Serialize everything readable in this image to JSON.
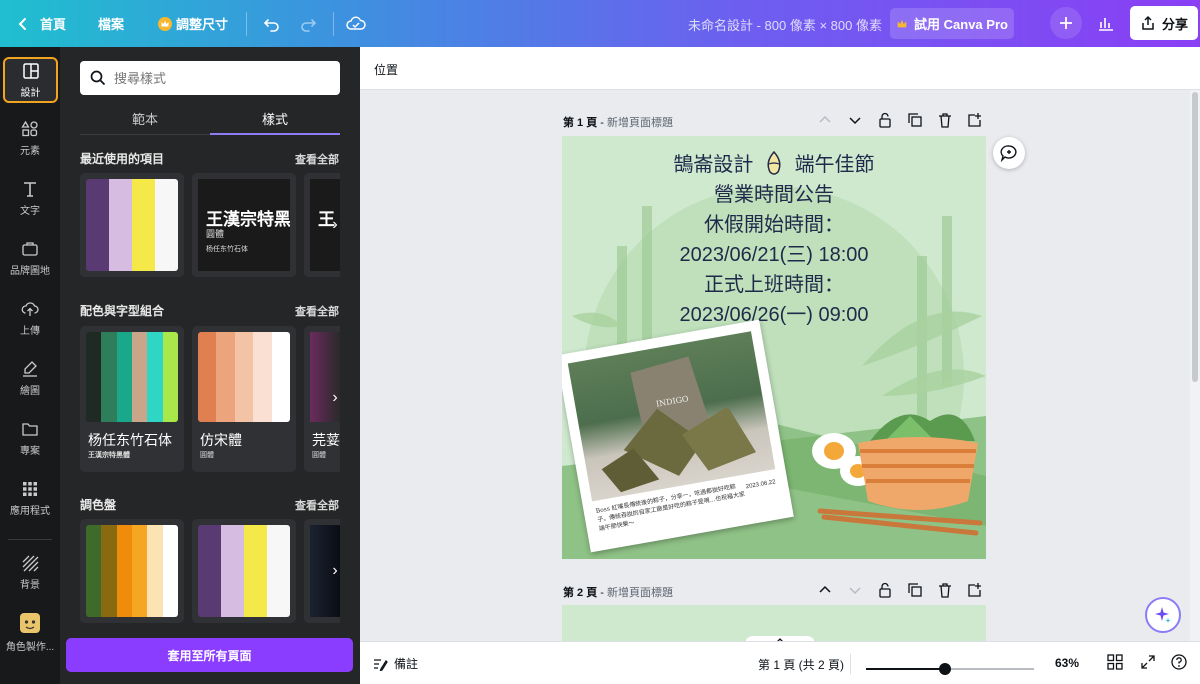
{
  "topbar": {
    "home": "首頁",
    "file": "檔案",
    "resize": "調整尺寸",
    "title": "未命名設計 - 800 像素 × 800 像素",
    "pro": "試用 Canva Pro",
    "share": "分享"
  },
  "rail": [
    {
      "label": "設計",
      "icon": "layout-icon"
    },
    {
      "label": "元素",
      "icon": "shapes-icon"
    },
    {
      "label": "文字",
      "icon": "text-icon"
    },
    {
      "label": "品牌圖地",
      "icon": "brand-icon"
    },
    {
      "label": "上傳",
      "icon": "upload-icon"
    },
    {
      "label": "繪圖",
      "icon": "draw-icon"
    },
    {
      "label": "專案",
      "icon": "folder-icon"
    },
    {
      "label": "應用程式",
      "icon": "apps-icon"
    },
    {
      "label": "背景",
      "icon": "background-icon"
    },
    {
      "label": "角色製作...",
      "icon": "character-icon"
    }
  ],
  "panel": {
    "search_placeholder": "搜尋樣式",
    "tab_templates": "範本",
    "tab_styles": "樣式",
    "recent_title": "最近使用的項目",
    "combo_title": "配色與字型組合",
    "palette_title": "調色盤",
    "see_all": "查看全部",
    "apply_all": "套用至所有頁面",
    "recent_font_main": "王漢宗特黑",
    "recent_font_sub": "圓體",
    "recent_font_small": "杨任东竹石体",
    "recent_font_3": "王",
    "combo_font1_main": "杨任东竹石体",
    "combo_font1_sub": "王漢宗特黑體",
    "combo_font2_main": "仿宋體",
    "combo_font2_sub": "圓體",
    "combo_font3_main": "芫荽",
    "combo_font3_sub": "圓體",
    "colors": {
      "recent_palette": [
        "#5a3a73",
        "#d6bce0",
        "#f5e94a",
        "#f7f7f7"
      ],
      "combo1": [
        "#1f2a24",
        "#2e7d5b",
        "#1aa88a",
        "#c9a58a",
        "#2fd6c6",
        "#a8e84a"
      ],
      "combo2": [
        "#e08050",
        "#eca47c",
        "#f3c3a6",
        "#f9e0d2",
        "#ffffff"
      ],
      "palette1": [
        "#3f6b2a",
        "#8a6a10",
        "#f08c0c",
        "#f5a623",
        "#fbe3b3",
        "#ffffff"
      ],
      "palette2": [
        "#5a3a73",
        "#d6bce0",
        "#f5e94a",
        "#f7f7f7"
      ]
    }
  },
  "canvas": {
    "position_label": "位置",
    "page1_label": "第 1 頁",
    "page1_sub": "新增頁面標題",
    "page2_label": "第 2 頁",
    "page2_sub": "新增頁面標題",
    "poster": {
      "line1": "鵠崙設計",
      "line1b": "端午佳節",
      "line2": "營業時間公告",
      "line3": "休假開始時間：",
      "line4": "2023/06/21(三) 18:00",
      "line5": "正式上班時間：",
      "line6": "2023/06/26(一) 09:00",
      "photo_caption": "Boss 紅嘴長傳統後的粽子，分享一，吃過都說好吃粽子。傳統吞說的自家工廠是好吃的粽子是唷...也祝福大家端午節快樂～",
      "photo_date": "2023.06.22",
      "bag_text": "INDIGO"
    }
  },
  "bottombar": {
    "notes": "備註",
    "page_indicator": "第 1 頁 (共 2 頁)",
    "zoom": "63%",
    "zoom_fraction": 0.63
  }
}
